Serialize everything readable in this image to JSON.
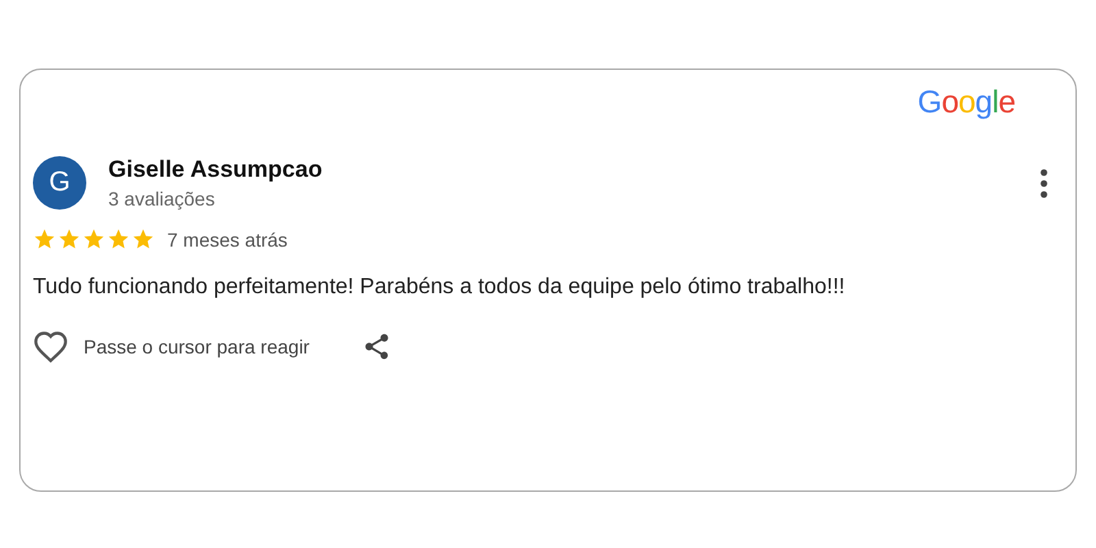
{
  "logo": "Google",
  "review": {
    "avatar_letter": "G",
    "author": "Giselle Assumpcao",
    "author_meta": "3 avaliações",
    "stars": 5,
    "time": "7 meses atrás",
    "text": "Tudo funcionando perfeitamente! Parabéns a todos da equipe pelo ótimo trabalho!!!",
    "react_hint": "Passe o cursor para reagir"
  }
}
